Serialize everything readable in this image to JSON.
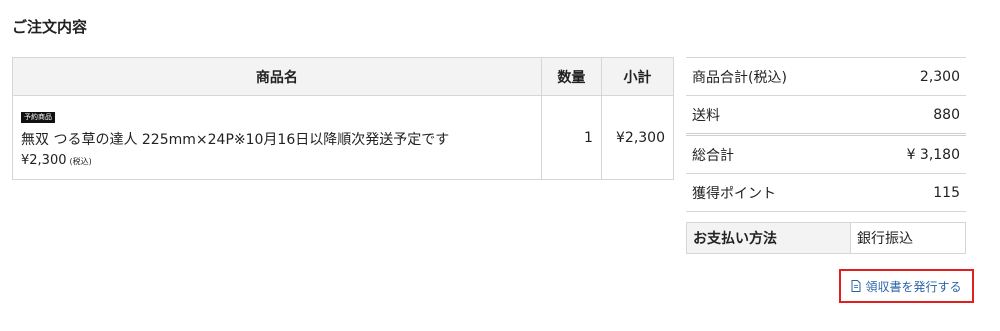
{
  "page": {
    "title": "ご注文内容"
  },
  "order_table": {
    "headers": {
      "name": "商品名",
      "quantity": "数量",
      "subtotal": "小計"
    },
    "items": [
      {
        "badge": "予約商品",
        "name": "無双 つる草の達人 225mm×24P※10月16日以降順次発送予定です",
        "price": "¥2,300",
        "tax_note": "(税込)",
        "quantity": "1",
        "subtotal": "¥2,300"
      }
    ]
  },
  "summary": {
    "rows": [
      {
        "label": "商品合計(税込)",
        "value": "2,300"
      },
      {
        "label": "送料",
        "value": "880"
      },
      {
        "label": "総合計",
        "value": "¥ 3,180"
      },
      {
        "label": "獲得ポイント",
        "value": "115"
      }
    ]
  },
  "payment": {
    "label": "お支払い方法",
    "value": "銀行振込"
  },
  "receipt": {
    "label": "領収書を発行する",
    "icon": "document-icon",
    "highlight_color": "#e02020",
    "link_color": "#2a64a8"
  }
}
